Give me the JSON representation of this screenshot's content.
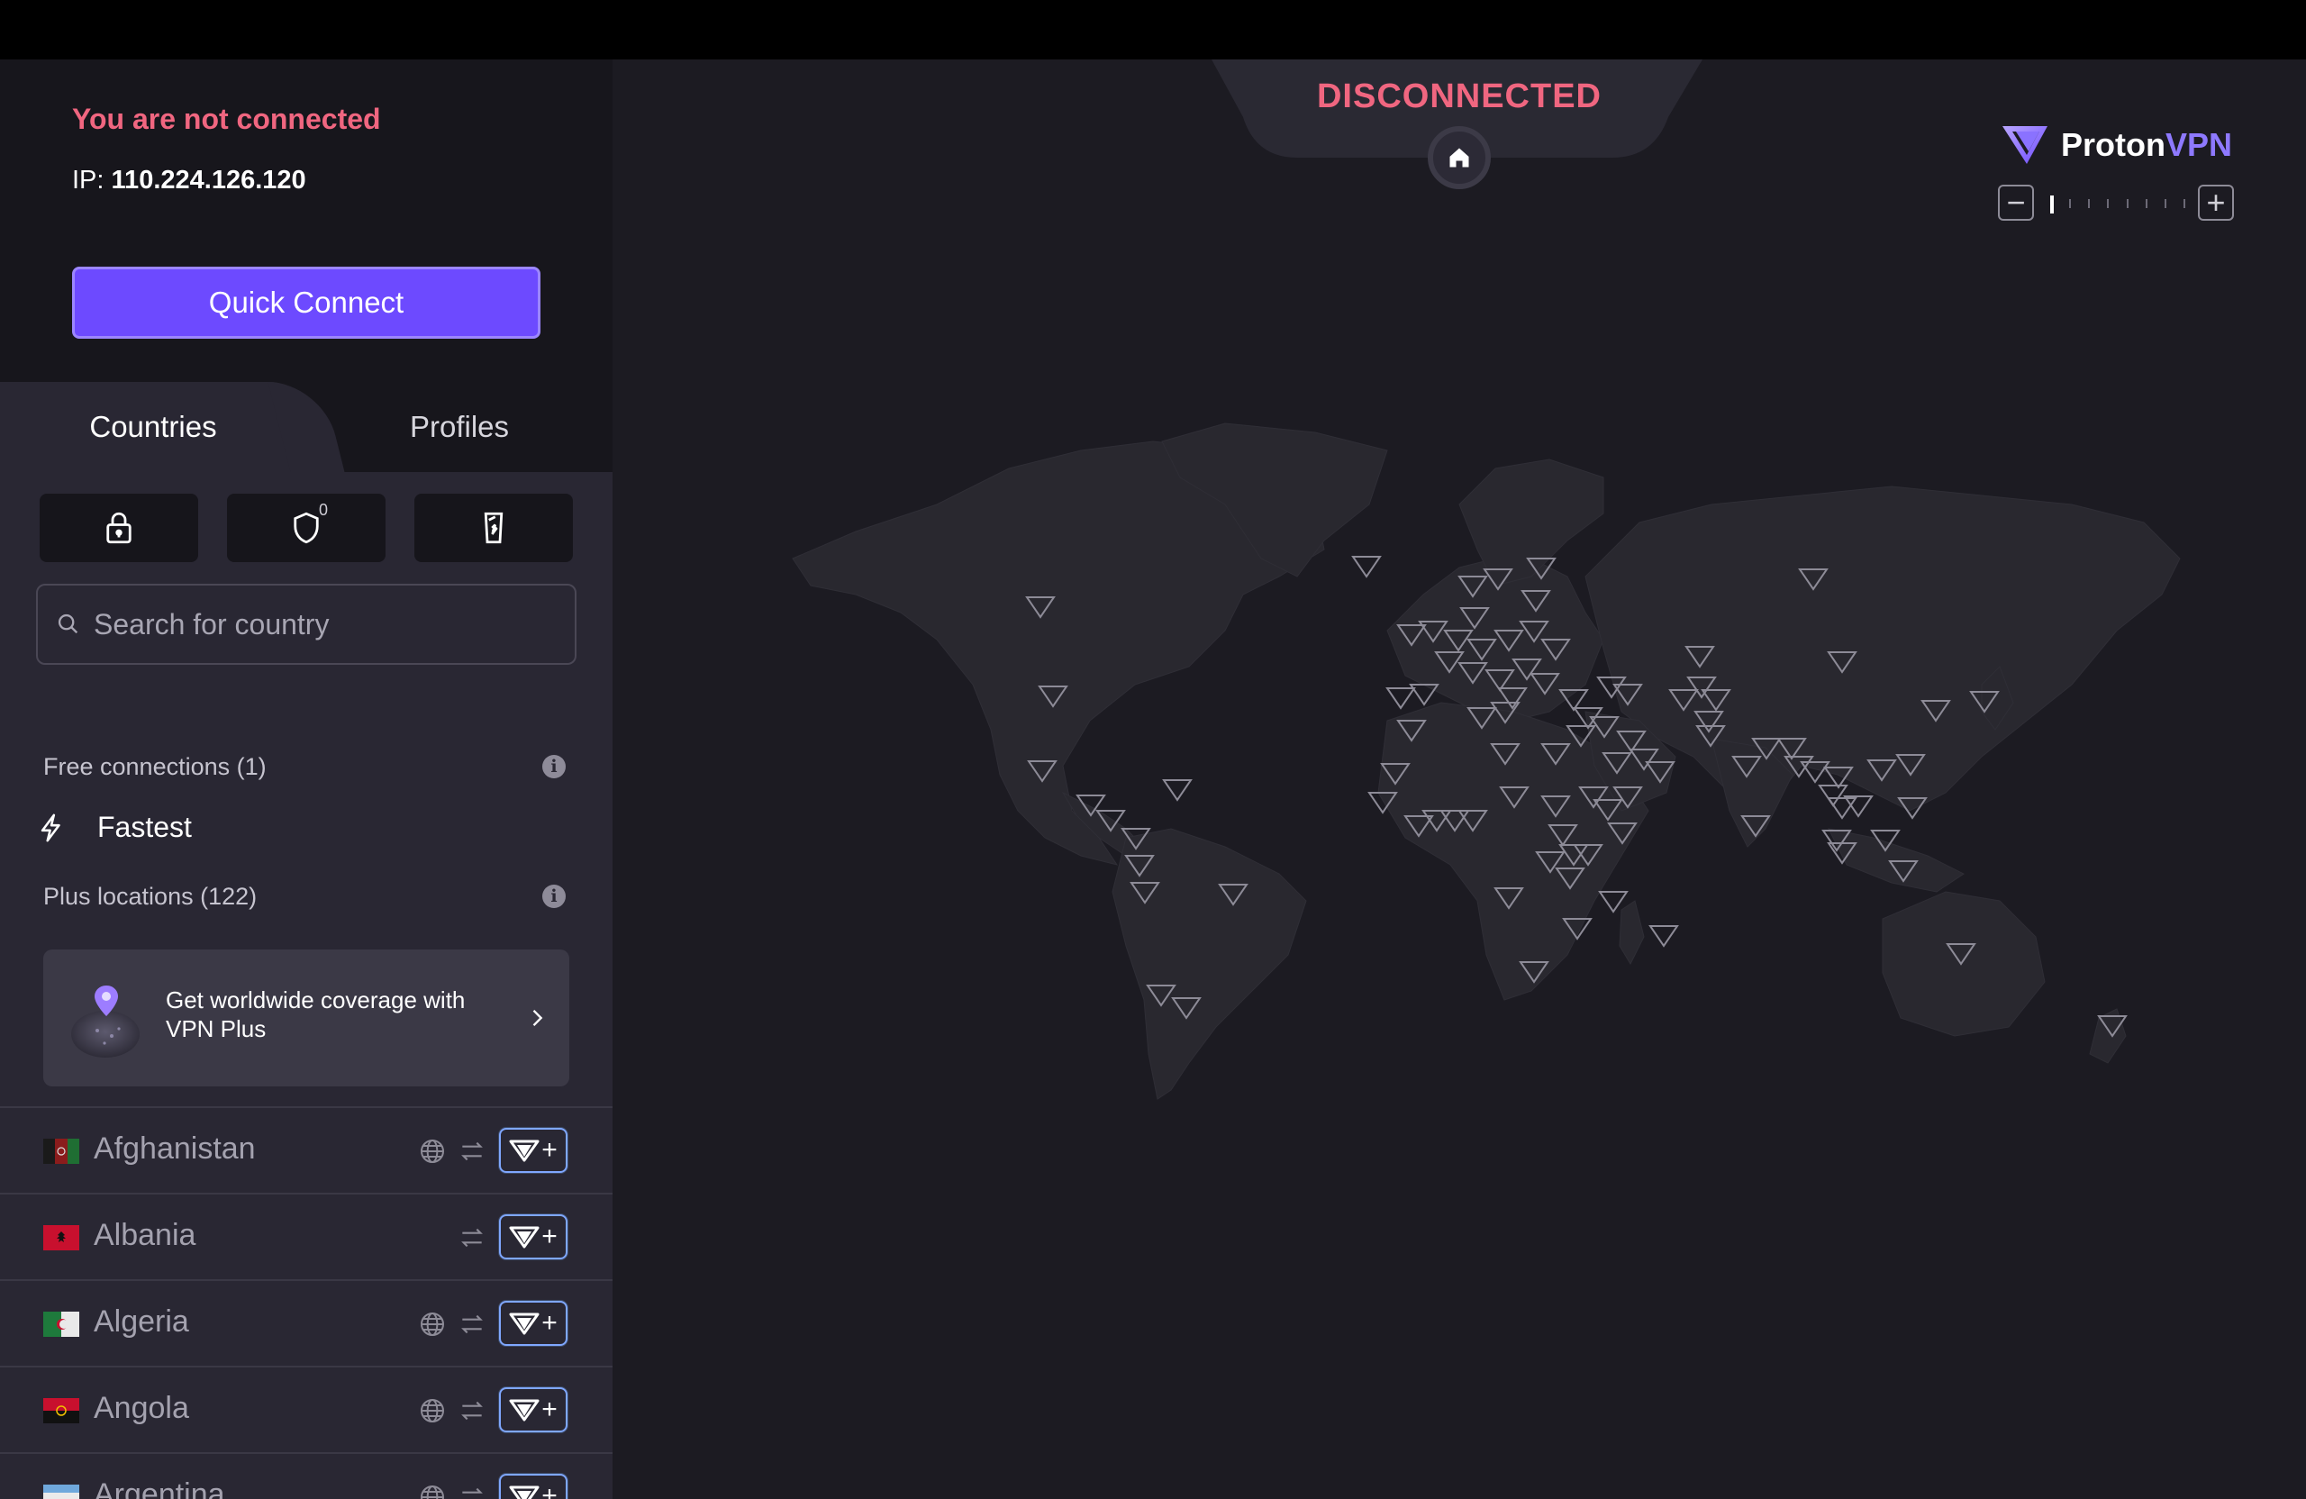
{
  "connection": {
    "status_title": "You are not connected",
    "ip_label": "IP:",
    "ip_value": "110.224.126.120",
    "quick_connect_label": "Quick Connect"
  },
  "tabs": [
    {
      "label": "Countries",
      "active": true
    },
    {
      "label": "Profiles",
      "active": false
    }
  ],
  "filters": {
    "secure_core_icon": "lock-icon",
    "netshield_icon": "shield-icon",
    "netshield_count": "0",
    "killswitch_icon": "device-icon"
  },
  "search": {
    "placeholder": "Search for country"
  },
  "free_section": {
    "label": "Free connections (1)",
    "fastest_label": "Fastest"
  },
  "plus_section": {
    "label": "Plus locations (122)"
  },
  "upsell": {
    "text": "Get worldwide coverage with VPN Plus"
  },
  "countries": [
    {
      "name": "Afghanistan",
      "tor": true,
      "p2p": true
    },
    {
      "name": "Albania",
      "tor": false,
      "p2p": true
    },
    {
      "name": "Algeria",
      "tor": true,
      "p2p": true
    },
    {
      "name": "Angola",
      "tor": true,
      "p2p": true
    },
    {
      "name": "Argentina",
      "tor": true,
      "p2p": true
    }
  ],
  "map": {
    "status_label": "DISCONNECTED",
    "brand_first": "Proton",
    "brand_second": "VPN",
    "zoom_minus": "−",
    "zoom_plus": "+",
    "zoom_level": 1,
    "zoom_steps": 8
  },
  "colors": {
    "accent": "#6d4aff",
    "danger": "#f06680",
    "sidebar_bg": "#17161c",
    "panel_bg": "#292733",
    "map_bg": "#1c1b22",
    "land": "#29282f"
  }
}
